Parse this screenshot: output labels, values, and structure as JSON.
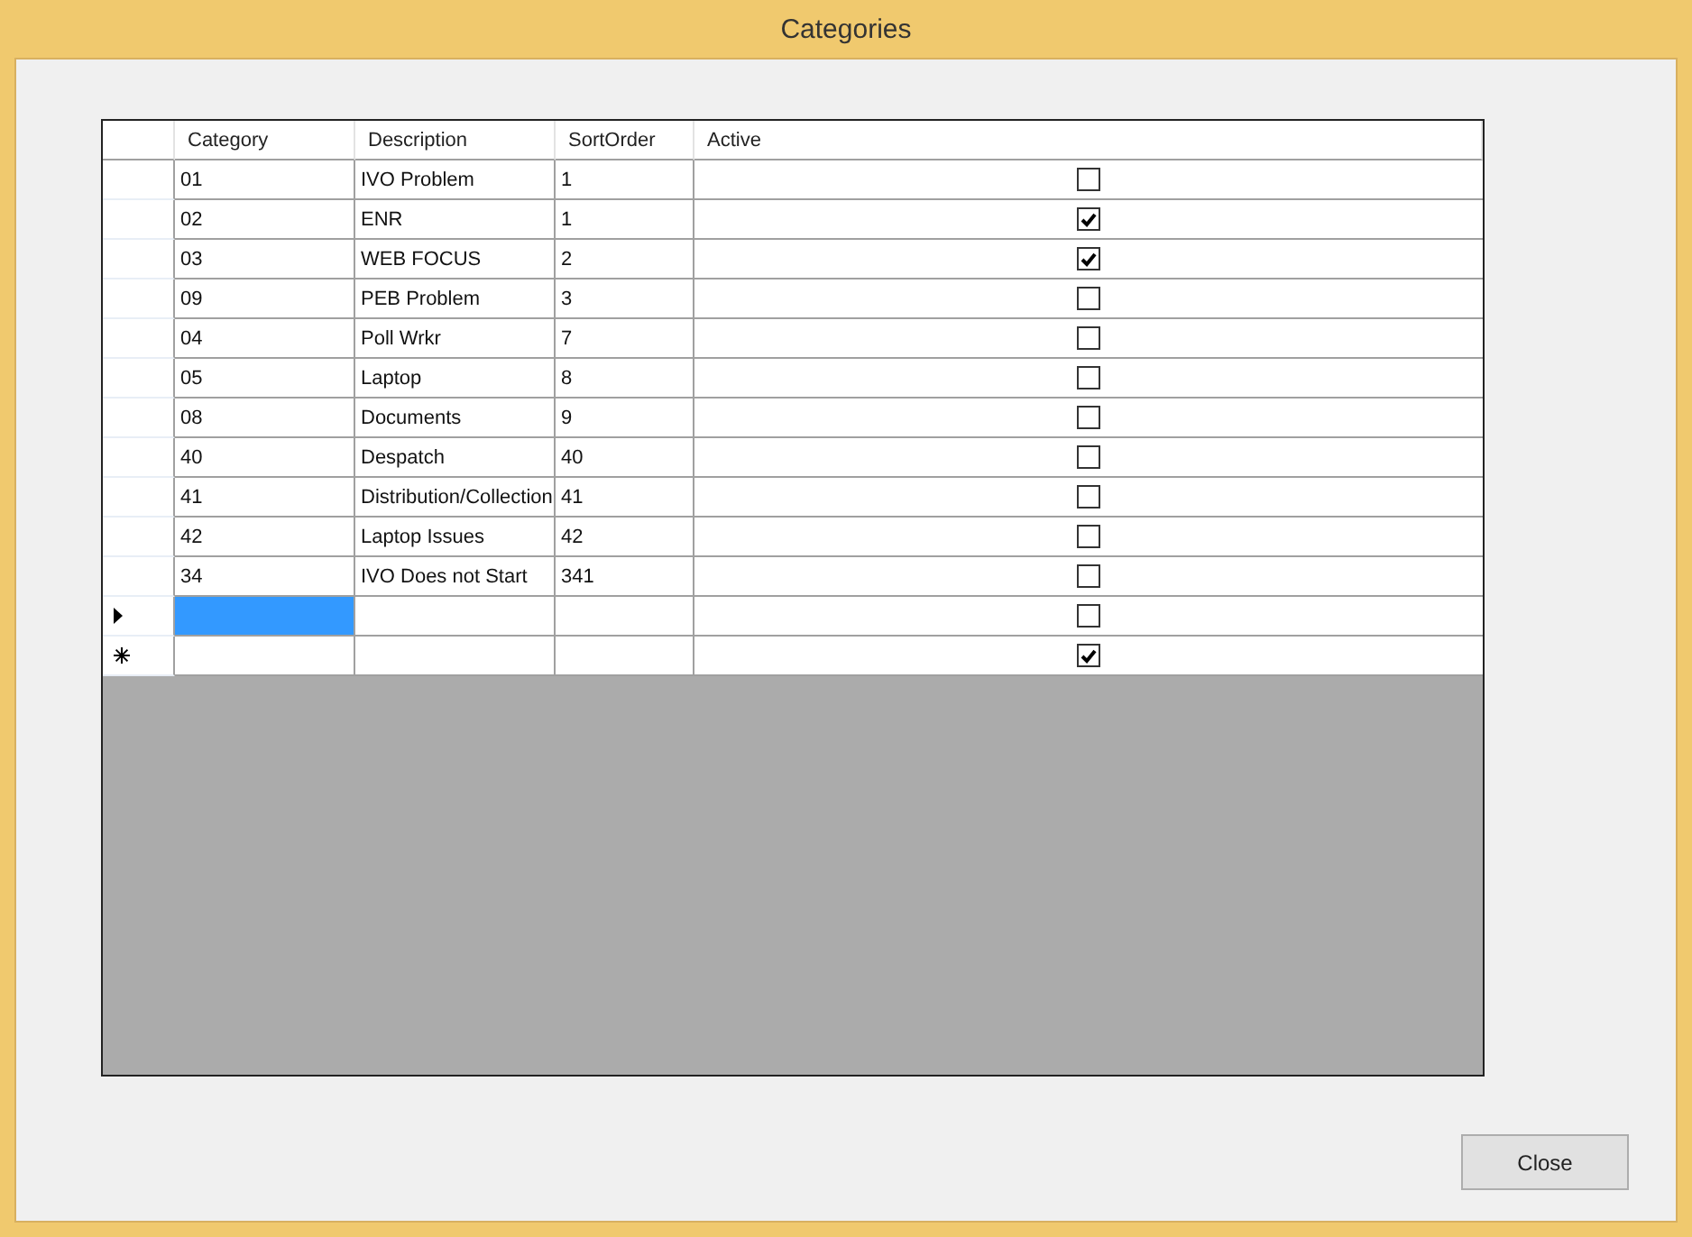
{
  "window": {
    "title": "Categories"
  },
  "grid": {
    "columns": [
      "Category",
      "Description",
      "SortOrder",
      "Active"
    ],
    "rows": [
      {
        "category": "01",
        "description": "IVO Problem",
        "sort_order": "1",
        "active": false,
        "selected": false
      },
      {
        "category": "02",
        "description": "ENR",
        "sort_order": "1",
        "active": true,
        "selected": false
      },
      {
        "category": "03",
        "description": "WEB FOCUS",
        "sort_order": "2",
        "active": true,
        "selected": false
      },
      {
        "category": "09",
        "description": "PEB Problem",
        "sort_order": "3",
        "active": false,
        "selected": false
      },
      {
        "category": "04",
        "description": "Poll Wrkr",
        "sort_order": "7",
        "active": false,
        "selected": false
      },
      {
        "category": "05",
        "description": "Laptop",
        "sort_order": "8",
        "active": false,
        "selected": false
      },
      {
        "category": "08",
        "description": "Documents",
        "sort_order": "9",
        "active": false,
        "selected": false
      },
      {
        "category": "40",
        "description": "Despatch",
        "sort_order": "40",
        "active": false,
        "selected": false
      },
      {
        "category": "41",
        "description": "Distribution/Collection",
        "sort_order": "41",
        "active": false,
        "selected": false
      },
      {
        "category": "42",
        "description": "Laptop Issues",
        "sort_order": "42",
        "active": false,
        "selected": false
      },
      {
        "category": "34",
        "description": "IVO Does not Start",
        "sort_order": "341",
        "active": false,
        "selected": false
      },
      {
        "kind": "current",
        "active": false,
        "selected": true
      },
      {
        "kind": "new",
        "active": true,
        "selected": false
      }
    ]
  },
  "buttons": [
    "Close"
  ]
}
